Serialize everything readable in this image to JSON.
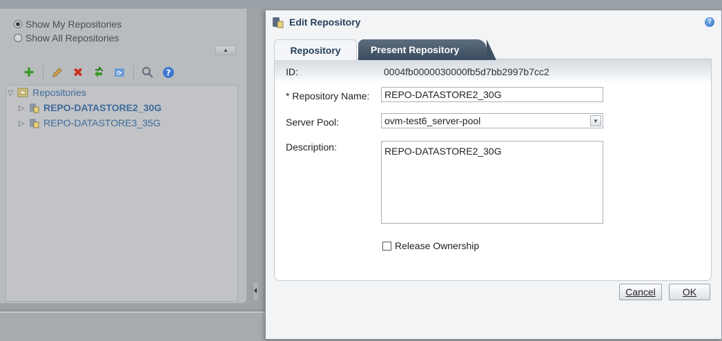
{
  "left": {
    "radio_my": "Show My Repositories",
    "radio_all": "Show All Repositories",
    "tree": {
      "root": "Repositories",
      "items": [
        "REPO-DATASTORE2_30G",
        "REPO-DATASTORE3_35G"
      ]
    }
  },
  "dialog": {
    "title": "Edit Repository",
    "tabs": [
      "Repository",
      "Present Repository"
    ],
    "id_label": "ID:",
    "id_value": "0004fb0000030000fb5d7bb2997b7cc2",
    "name_label": "* Repository Name:",
    "name_value": "REPO-DATASTORE2_30G",
    "pool_label": "Server Pool:",
    "pool_value": "ovm-test6_server-pool",
    "desc_label": "Description:",
    "desc_value": "REPO-DATASTORE2_30G",
    "release_label": "Release Ownership",
    "cancel_label": "Cancel",
    "ok_label": "OK"
  },
  "colors": {
    "dialog_title": "#263f5a",
    "tab_dark": "#3a4b5e",
    "tree_link": "#3e6a9a"
  }
}
